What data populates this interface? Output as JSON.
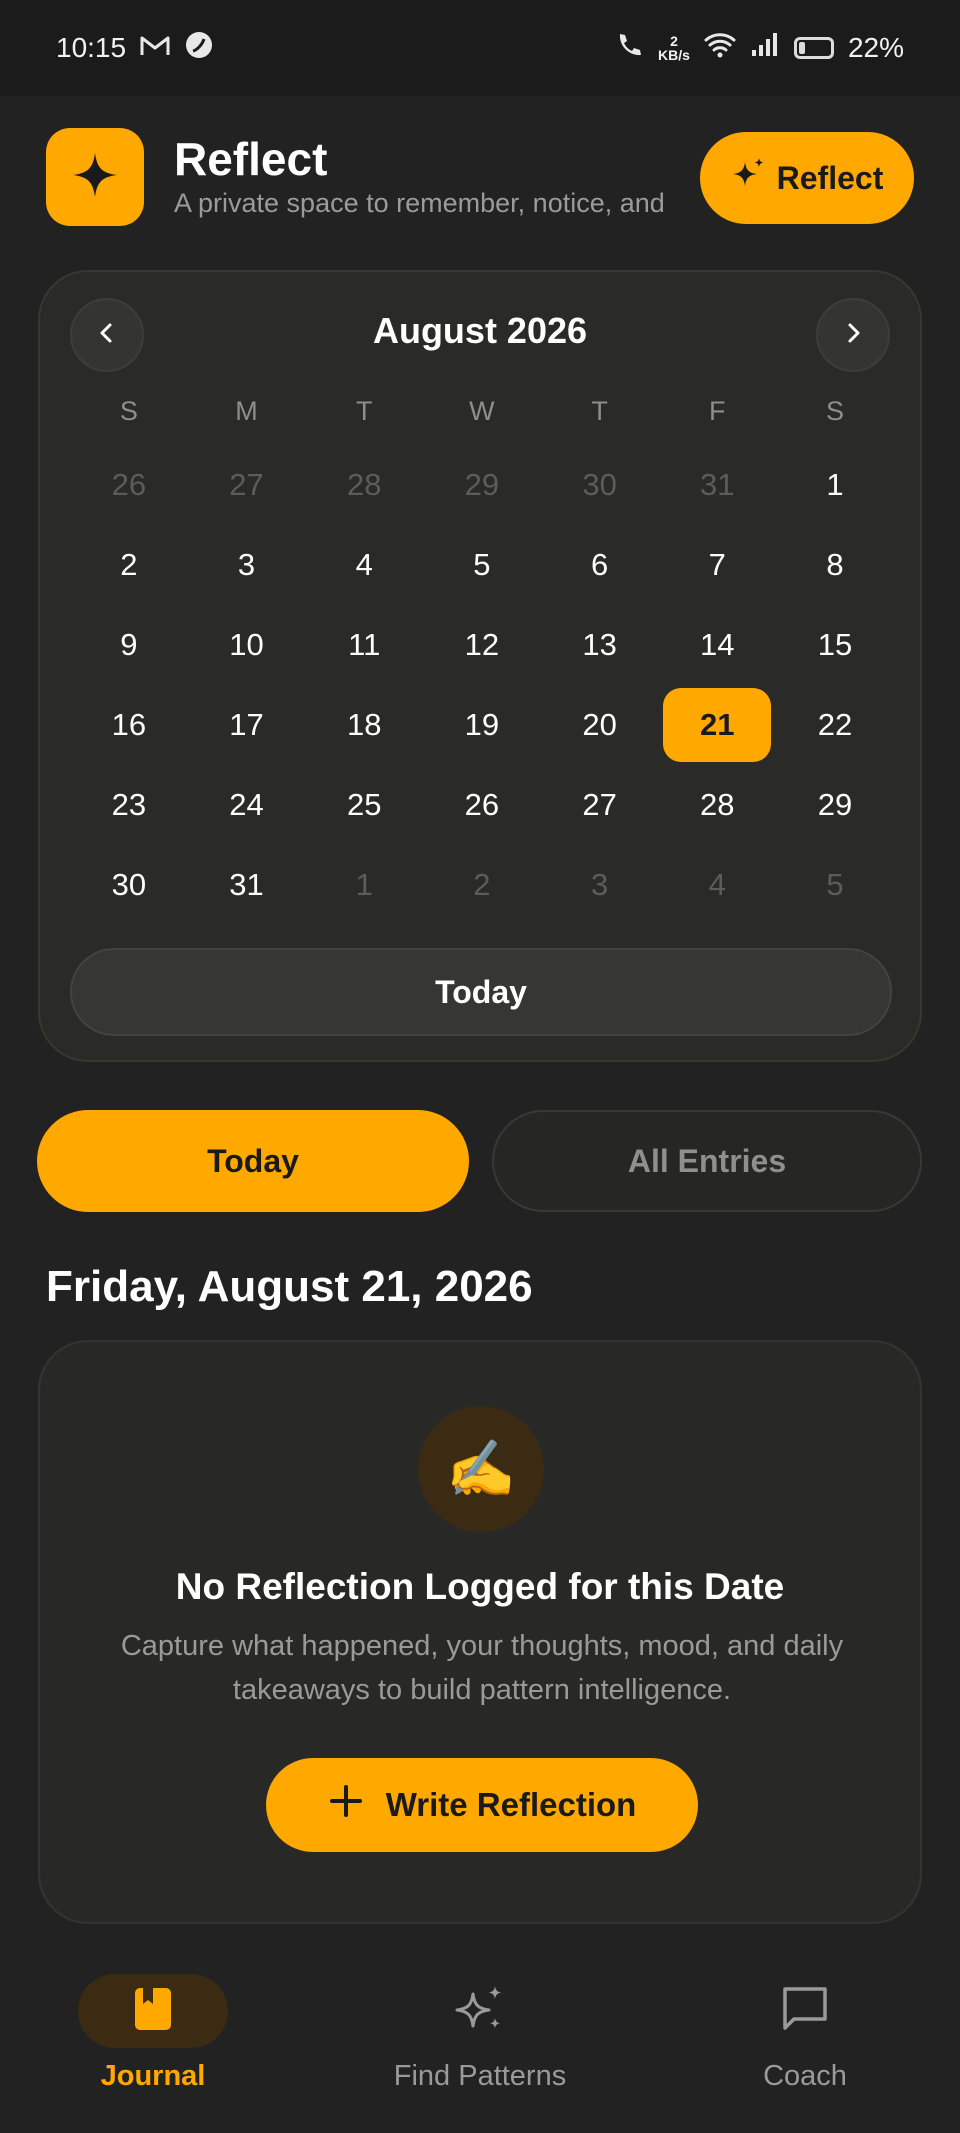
{
  "status_bar": {
    "time": "10:15",
    "net_speed_value": "2",
    "net_speed_unit": "KB/s",
    "battery": "22%"
  },
  "header": {
    "title": "Reflect",
    "subtitle": "A private space to remember, notice, and",
    "reflect_button": "Reflect"
  },
  "calendar": {
    "month_label": "August 2026",
    "weekdays": [
      "S",
      "M",
      "T",
      "W",
      "T",
      "F",
      "S"
    ],
    "weeks": [
      [
        "26",
        "27",
        "28",
        "29",
        "30",
        "31",
        "1"
      ],
      [
        "2",
        "3",
        "4",
        "5",
        "6",
        "7",
        "8"
      ],
      [
        "9",
        "10",
        "11",
        "12",
        "13",
        "14",
        "15"
      ],
      [
        "16",
        "17",
        "18",
        "19",
        "20",
        "21",
        "22"
      ],
      [
        "23",
        "24",
        "25",
        "26",
        "27",
        "28",
        "29"
      ],
      [
        "30",
        "31",
        "1",
        "2",
        "3",
        "4",
        "5"
      ]
    ],
    "selected_day": "21",
    "today_button": "Today"
  },
  "tabs": {
    "today": "Today",
    "all_entries": "All Entries"
  },
  "date_heading": "Friday, August 21, 2026",
  "empty_state": {
    "emoji": "✍️",
    "title": "No Reflection Logged for this Date",
    "description": "Capture what happened, your thoughts, mood, and daily takeaways to build pattern intelligence.",
    "button": "Write Reflection"
  },
  "bottom_nav": {
    "journal": "Journal",
    "find_patterns": "Find Patterns",
    "coach": "Coach"
  },
  "colors": {
    "accent": "#ffa800",
    "background": "#222222",
    "card": "#2a2a28"
  }
}
